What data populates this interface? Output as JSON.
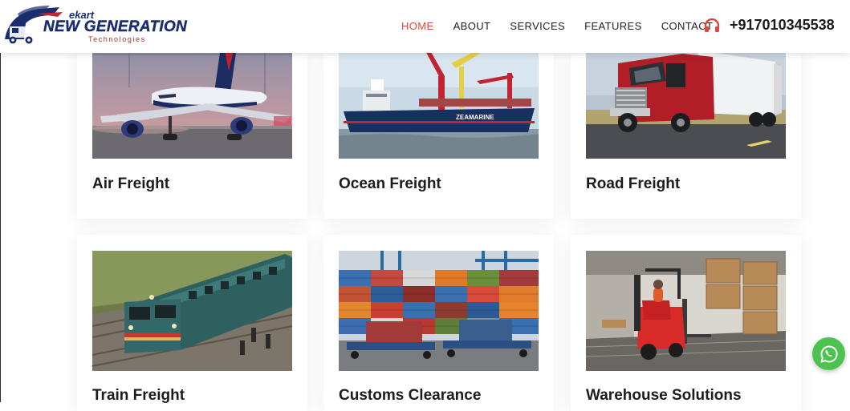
{
  "brand": {
    "ekart": "ekart",
    "name": "NEW GENERATION",
    "tagline": "Technologies",
    "colors": {
      "navy": "#1b2d6e",
      "red": "#c0262d"
    }
  },
  "nav": {
    "items": [
      {
        "label": "HOME",
        "active": true
      },
      {
        "label": "ABOUT",
        "active": false
      },
      {
        "label": "SERVICES",
        "active": false
      },
      {
        "label": "FEATURES",
        "active": false
      },
      {
        "label": "CONTACT",
        "active": false
      }
    ],
    "active_color": "#e0463c"
  },
  "contact": {
    "phone": "+917010345538",
    "icon": "headphones-icon",
    "icon_color": "#e0463c"
  },
  "services": [
    {
      "title": "Air Freight",
      "image": "airplane-photo"
    },
    {
      "title": "Ocean Freight",
      "image": "cargo-ship-photo"
    },
    {
      "title": "Road Freight",
      "image": "truck-photo"
    },
    {
      "title": "Train Freight",
      "image": "train-photo"
    },
    {
      "title": "Customs Clearance",
      "image": "shipping-containers-photo"
    },
    {
      "title": "Warehouse Solutions",
      "image": "forklift-warehouse-photo"
    }
  ],
  "floating": {
    "whatsapp_icon": "whatsapp-icon",
    "color": "#4cc34e"
  }
}
